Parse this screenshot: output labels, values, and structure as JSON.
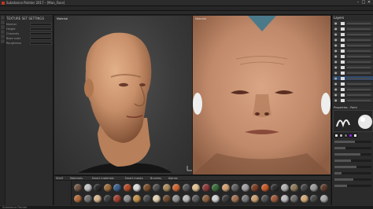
{
  "window": {
    "title": "Substance Painter 2017 - [Man_Face]",
    "minimize": "–",
    "maximize": "□",
    "close": "✕"
  },
  "left_panel": {
    "title": "TEXTURE SET SETTINGS",
    "rows": [
      {
        "label": "Normal"
      },
      {
        "label": "Height"
      },
      {
        "label": "Channels"
      },
      {
        "label": "Base color"
      },
      {
        "label": "Roughness"
      }
    ]
  },
  "viewport_3d": {
    "label": "Material"
  },
  "viewport_2d": {
    "label": "Material"
  },
  "layers_panel": {
    "title": "Layers",
    "rows": [
      {
        "name": "layer-1",
        "active": false
      },
      {
        "name": "layer-2",
        "active": false
      },
      {
        "name": "layer-3",
        "active": false
      },
      {
        "name": "layer-4",
        "active": false
      },
      {
        "name": "layer-5",
        "active": false
      },
      {
        "name": "layer-6",
        "active": false
      },
      {
        "name": "layer-7",
        "active": false
      },
      {
        "name": "layer-8",
        "active": false
      },
      {
        "name": "layer-9",
        "active": false
      },
      {
        "name": "layer-10",
        "active": false
      },
      {
        "name": "layer-11",
        "active": true
      },
      {
        "name": "layer-12",
        "active": false
      },
      {
        "name": "layer-13",
        "active": false
      },
      {
        "name": "layer-14",
        "active": false
      },
      {
        "name": "layer-15",
        "active": false
      }
    ]
  },
  "properties": {
    "title": "Properties - Paint",
    "swatch_colors": [
      "#e6e6e6",
      "#b0b0b0",
      "#6b6b6b",
      "#8a2be2",
      "#ffffff"
    ],
    "slider_fill": [
      0.55,
      0.3,
      0.7,
      0.45,
      0.6,
      0.2,
      0.5,
      0.35
    ]
  },
  "shelf": {
    "tabs": [
      "Shelf",
      "Materials",
      "Smart materials",
      "Smart masks",
      "Brushes",
      "Alphas"
    ],
    "materials_row1": [
      "#6e5443",
      "#c0c0c0",
      "#2a2a2a",
      "#9c6b3c",
      "#3b5f8a",
      "#b34a2a",
      "#d8d8d8",
      "#7a4e2a",
      "#4f4f4f",
      "#a88a5c",
      "#cc6633",
      "#555555",
      "#e0c090",
      "#8b3a3a",
      "#3a6b3a",
      "#d0a070",
      "#606060",
      "#a0a0a0",
      "#7a3f25",
      "#c85a2a",
      "#2f2f2f",
      "#b0b0b0",
      "#8c7a5a",
      "#444444",
      "#9a9a9a",
      "#5a3a2a"
    ],
    "materials_row2": [
      "#b06a3a",
      "#707070",
      "#d4b48c",
      "#3c3c3c",
      "#a04030",
      "#8c8c8c",
      "#c0904a",
      "#4a4a4a",
      "#e0d0b0",
      "#6a4a30",
      "#909090",
      "#b8b8b8",
      "#5a5a5a",
      "#8a6040",
      "#cfcfcf",
      "#3a3a3a",
      "#a07050",
      "#787878",
      "#c8a070",
      "#505050",
      "#9c5a3a",
      "#bababa",
      "#6c6c6c",
      "#d2a878",
      "#484848",
      "#a8a8a8"
    ]
  },
  "status": {
    "text": "Substance Painter"
  }
}
